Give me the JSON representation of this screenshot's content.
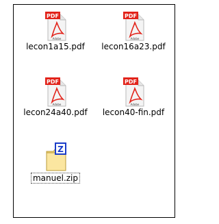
{
  "files": [
    {
      "name": "lecon1a15.pdf",
      "type": "pdf",
      "badge": "PDF",
      "brand": "Adobe"
    },
    {
      "name": "lecon16a23.pdf",
      "type": "pdf",
      "badge": "PDF",
      "brand": "Adobe"
    },
    {
      "name": "lecon24a40.pdf",
      "type": "pdf",
      "badge": "PDF",
      "brand": "Adobe"
    },
    {
      "name": "lecon40-fin.pdf",
      "type": "pdf",
      "badge": "PDF",
      "brand": "Adobe"
    },
    {
      "name": "manuel.zip",
      "type": "zip",
      "badge": "Z",
      "selected": true
    }
  ],
  "colors": {
    "pdf_red": "#e2231a",
    "zip_folder": "#f5d77a",
    "zip_blue": "#1a3cc8"
  },
  "icons": {
    "pdf": "pdf-file-icon",
    "zip": "zip-file-icon"
  }
}
